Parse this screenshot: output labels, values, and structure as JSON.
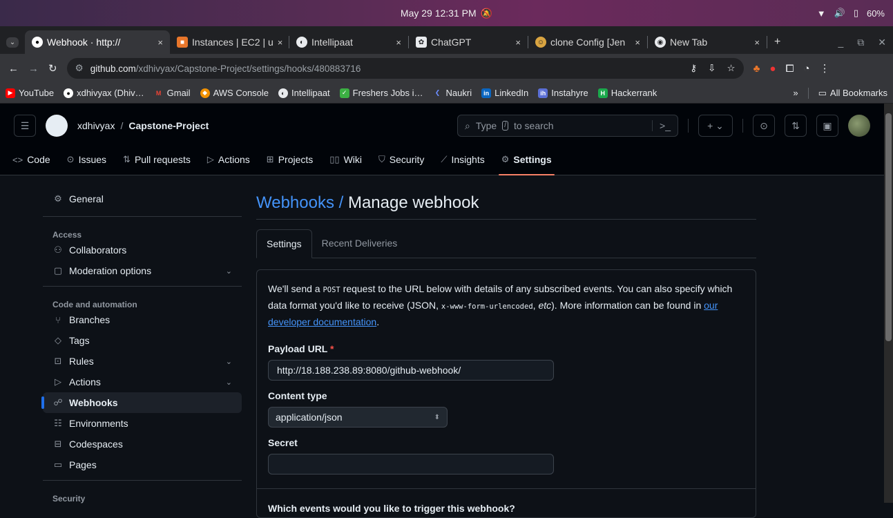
{
  "os": {
    "datetime": "May 29  12:31 PM",
    "battery": "60%"
  },
  "browser": {
    "tabs": [
      {
        "title": "Webhook · http://",
        "active": true
      },
      {
        "title": "Instances | EC2 | u"
      },
      {
        "title": "Intellipaat"
      },
      {
        "title": "ChatGPT"
      },
      {
        "title": "clone Config [Jen"
      },
      {
        "title": "New Tab"
      }
    ],
    "url_host": "github.com",
    "url_path": "/xdhivyax/Capstone-Project/settings/hooks/480883716",
    "bookmarks": [
      "YouTube",
      "xdhivyax (Dhiv…",
      "Gmail",
      "AWS Console",
      "Intellipaat",
      "Freshers Jobs i…",
      "Naukri",
      "LinkedIn",
      "Instahyre",
      "Hackerrank"
    ],
    "all_bookmarks": "All Bookmarks",
    "more_bookmarks": "»"
  },
  "github": {
    "owner": "xdhivyax",
    "separator": "/",
    "repo": "Capstone-Project",
    "search_prefix": "Type",
    "search_kbd": "/",
    "search_suffix": "to search",
    "nav": [
      "Code",
      "Issues",
      "Pull requests",
      "Actions",
      "Projects",
      "Wiki",
      "Security",
      "Insights",
      "Settings"
    ]
  },
  "sidebar": {
    "general": "General",
    "access_heading": "Access",
    "collaborators": "Collaborators",
    "moderation": "Moderation options",
    "code_heading": "Code and automation",
    "branches": "Branches",
    "tags": "Tags",
    "rules": "Rules",
    "actions": "Actions",
    "webhooks": "Webhooks",
    "environments": "Environments",
    "codespaces": "Codespaces",
    "pages": "Pages",
    "security_heading": "Security"
  },
  "main": {
    "crumb": "Webhooks /",
    "title": "Manage webhook",
    "tab_settings": "Settings",
    "tab_deliveries": "Recent Deliveries",
    "desc_1": "We'll send a",
    "desc_post": "POST",
    "desc_2": "request to the URL below with details of any subscribed events. You can also specify which data format you'd like to receive (JSON,",
    "desc_form": "x-www-form-urlencoded",
    "desc_3": ",",
    "desc_etc": "etc",
    "desc_4": "). More information can be found in",
    "desc_link": "our developer documentation",
    "desc_5": ".",
    "payload_label": "Payload URL",
    "payload_req": "*",
    "payload_value": "http://18.188.238.89:8080/github-webhook/",
    "content_label": "Content type",
    "content_value": "application/json",
    "secret_label": "Secret",
    "secret_value": "",
    "events_label": "Which events would you like to trigger this webhook?"
  }
}
